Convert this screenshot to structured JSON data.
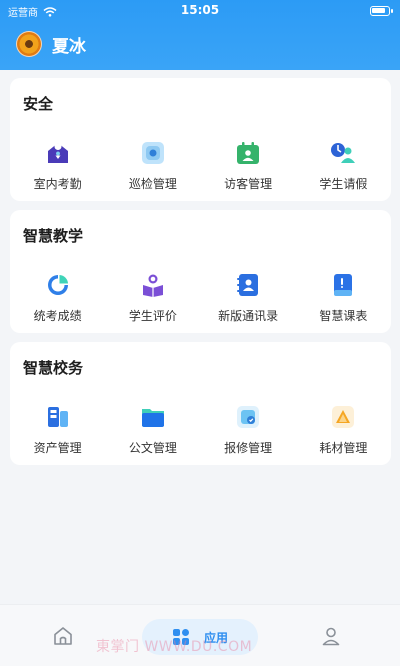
{
  "status_bar": {
    "carrier": "运营商",
    "time": "15:05"
  },
  "user": {
    "name": "夏冰"
  },
  "sections": [
    {
      "title": "安全",
      "items": [
        {
          "label": "室内考勤",
          "icon": "home-attendance-icon"
        },
        {
          "label": "巡检管理",
          "icon": "patrol-icon"
        },
        {
          "label": "访客管理",
          "icon": "visitor-calendar-icon"
        },
        {
          "label": "学生请假",
          "icon": "student-leave-icon"
        }
      ]
    },
    {
      "title": "智慧教学",
      "items": [
        {
          "label": "统考成绩",
          "icon": "exam-score-chart-icon"
        },
        {
          "label": "学生评价",
          "icon": "student-evaluation-icon"
        },
        {
          "label": "新版通讯录",
          "icon": "contacts-book-icon"
        },
        {
          "label": "智慧课表",
          "icon": "timetable-book-icon"
        }
      ]
    },
    {
      "title": "智慧校务",
      "items": [
        {
          "label": "资产管理",
          "icon": "asset-icon"
        },
        {
          "label": "公文管理",
          "icon": "document-folder-icon"
        },
        {
          "label": "报修管理",
          "icon": "repair-icon"
        },
        {
          "label": "耗材管理",
          "icon": "consumables-icon"
        }
      ]
    }
  ],
  "tabbar": {
    "apps_label": "应用"
  },
  "watermark": "東掌门 WWW.DU.COM",
  "colors": {
    "header": "#2c9bf5",
    "accent": "#2f8ff0",
    "background": "#f3f5f8"
  }
}
